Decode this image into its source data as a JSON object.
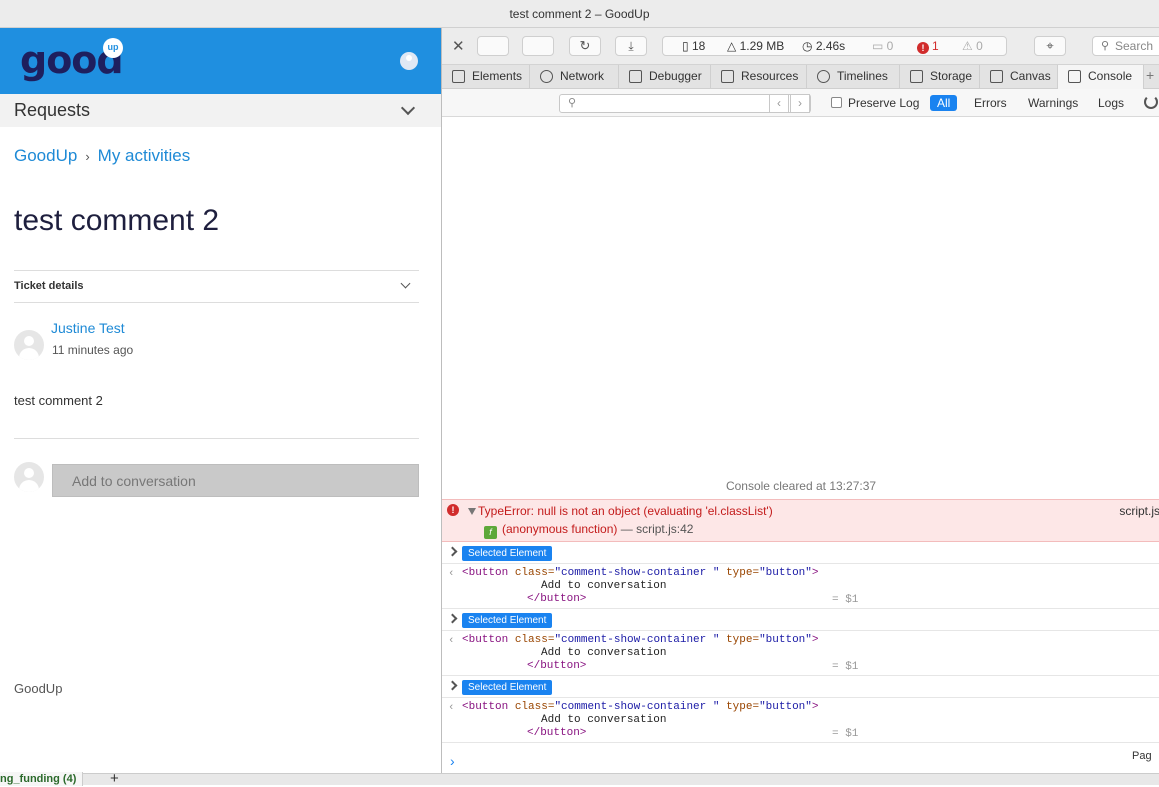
{
  "window": {
    "title": "test comment 2 – GoodUp"
  },
  "app": {
    "logo_text": "good",
    "logo_badge": "up",
    "requests_label": "Requests",
    "breadcrumb": {
      "home": "GoodUp",
      "section": "My activities"
    },
    "page_title": "test comment 2",
    "ticket_details_label": "Ticket details",
    "comment": {
      "author": "Justine Test",
      "time": "11 minutes ago",
      "body": "test comment 2"
    },
    "add_conversation_label": "Add to conversation",
    "footer_brand": "GoodUp"
  },
  "bottom_bar": {
    "tab_label": "ng_funding (4)",
    "add_label": "+"
  },
  "devtools": {
    "toolbar": {
      "resources_count": "18",
      "size": "1.29 MB",
      "load_time": "2.46s",
      "logs_count": "0",
      "errors_count": "1",
      "warnings_count": "0",
      "search_placeholder": "Search"
    },
    "tabs": [
      {
        "label": "Elements",
        "icon": "elements-icon"
      },
      {
        "label": "Network",
        "icon": "network-icon"
      },
      {
        "label": "Debugger",
        "icon": "debugger-icon"
      },
      {
        "label": "Resources",
        "icon": "resources-icon"
      },
      {
        "label": "Timelines",
        "icon": "timelines-icon"
      },
      {
        "label": "Storage",
        "icon": "storage-icon"
      },
      {
        "label": "Canvas",
        "icon": "canvas-icon"
      },
      {
        "label": "Console",
        "icon": "console-icon",
        "active": true
      }
    ],
    "filter": {
      "preserve_log": "Preserve Log",
      "buttons": [
        "All",
        "Errors",
        "Warnings",
        "Logs"
      ],
      "active": "All"
    },
    "console": {
      "cleared_text": "Console cleared at 13:27:37",
      "error": {
        "message": "TypeError: null is not an object (evaluating 'el.classList')",
        "source": "script.js",
        "frame_fn": "(anonymous function)",
        "frame_sep": " — ",
        "frame_loc": "script.js:42"
      },
      "selected_label": "Selected Element",
      "code": {
        "open_tag_start": "<button",
        "attr1_name": " class=",
        "attr1_value": "\"comment-show-container \"",
        "attr2_name": " type=",
        "attr2_value": "\"button\"",
        "open_tag_end": ">",
        "inner_text": "Add to conversation",
        "close_tag": "</button>",
        "result": "= $1"
      },
      "page_cut_label": "Pag"
    }
  }
}
